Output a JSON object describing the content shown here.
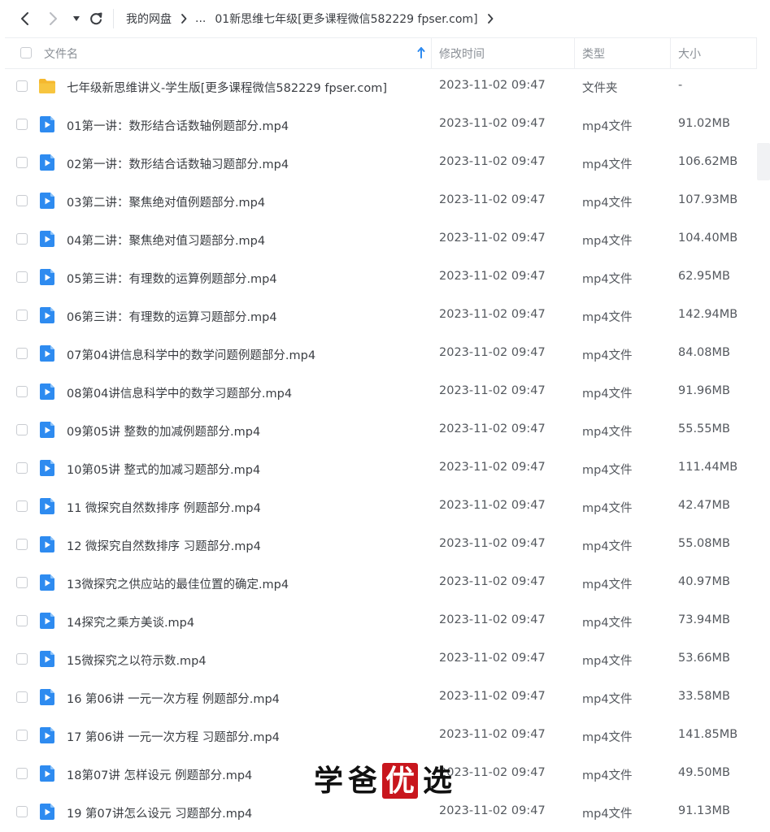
{
  "nav": {
    "back_icon": "chevron-left-icon",
    "forward_icon": "chevron-right-icon",
    "dropdown_icon": "caret-down-icon",
    "refresh_icon": "refresh-icon"
  },
  "breadcrumb": {
    "root": "我的网盘",
    "ellipsis": "...",
    "current": "01新思维七年级[更多课程微信582229 fpser.com]"
  },
  "header": {
    "name": "文件名",
    "modified": "修改时间",
    "type": "类型",
    "size": "大小"
  },
  "colors": {
    "folder": "#f7c53f",
    "video": "#2e8bf0",
    "sort_arrow": "#2e8bf0",
    "watermark_red": "#c8161d"
  },
  "files": [
    {
      "name": "七年级新思维讲义-学生版[更多课程微信582229 fpser.com]",
      "time": "2023-11-02 09:47",
      "type": "文件夹",
      "size": "-",
      "icon": "folder-icon"
    },
    {
      "name": "01第一讲：数形结合话数轴例题部分.mp4",
      "time": "2023-11-02 09:47",
      "type": "mp4文件",
      "size": "91.02MB",
      "icon": "video-file-icon"
    },
    {
      "name": "02第一讲：数形结合话数轴习题部分.mp4",
      "time": "2023-11-02 09:47",
      "type": "mp4文件",
      "size": "106.62MB",
      "icon": "video-file-icon"
    },
    {
      "name": "03第二讲：聚焦绝对值例题部分.mp4",
      "time": "2023-11-02 09:47",
      "type": "mp4文件",
      "size": "107.93MB",
      "icon": "video-file-icon"
    },
    {
      "name": "04第二讲：聚焦绝对值习题部分.mp4",
      "time": "2023-11-02 09:47",
      "type": "mp4文件",
      "size": "104.40MB",
      "icon": "video-file-icon"
    },
    {
      "name": "05第三讲：有理数的运算例题部分.mp4",
      "time": "2023-11-02 09:47",
      "type": "mp4文件",
      "size": "62.95MB",
      "icon": "video-file-icon"
    },
    {
      "name": "06第三讲：有理数的运算习题部分.mp4",
      "time": "2023-11-02 09:47",
      "type": "mp4文件",
      "size": "142.94MB",
      "icon": "video-file-icon"
    },
    {
      "name": "07第04讲信息科学中的数学问题例题部分.mp4",
      "time": "2023-11-02 09:47",
      "type": "mp4文件",
      "size": "84.08MB",
      "icon": "video-file-icon"
    },
    {
      "name": "08第04讲信息科学中的数学习题部分.mp4",
      "time": "2023-11-02 09:47",
      "type": "mp4文件",
      "size": "91.96MB",
      "icon": "video-file-icon"
    },
    {
      "name": "09第05讲 整数的加减例题部分.mp4",
      "time": "2023-11-02 09:47",
      "type": "mp4文件",
      "size": "55.55MB",
      "icon": "video-file-icon"
    },
    {
      "name": "10第05讲 整式的加减习题部分.mp4",
      "time": "2023-11-02 09:47",
      "type": "mp4文件",
      "size": "111.44MB",
      "icon": "video-file-icon"
    },
    {
      "name": "11 微探究自然数排序 例题部分.mp4",
      "time": "2023-11-02 09:47",
      "type": "mp4文件",
      "size": "42.47MB",
      "icon": "video-file-icon"
    },
    {
      "name": "12 微探究自然数排序 习题部分.mp4",
      "time": "2023-11-02 09:47",
      "type": "mp4文件",
      "size": "55.08MB",
      "icon": "video-file-icon"
    },
    {
      "name": "13微探究之供应站的最佳位置的确定.mp4",
      "time": "2023-11-02 09:47",
      "type": "mp4文件",
      "size": "40.97MB",
      "icon": "video-file-icon"
    },
    {
      "name": "14探究之乘方美谈.mp4",
      "time": "2023-11-02 09:47",
      "type": "mp4文件",
      "size": "73.94MB",
      "icon": "video-file-icon"
    },
    {
      "name": "15微探究之以符示数.mp4",
      "time": "2023-11-02 09:47",
      "type": "mp4文件",
      "size": "53.66MB",
      "icon": "video-file-icon"
    },
    {
      "name": "16 第06讲 一元一次方程 例题部分.mp4",
      "time": "2023-11-02 09:47",
      "type": "mp4文件",
      "size": "33.58MB",
      "icon": "video-file-icon"
    },
    {
      "name": "17 第06讲 一元一次方程 习题部分.mp4",
      "time": "2023-11-02 09:47",
      "type": "mp4文件",
      "size": "141.85MB",
      "icon": "video-file-icon"
    },
    {
      "name": "18第07讲 怎样设元 例题部分.mp4",
      "time": "2023-11-02 09:47",
      "type": "mp4文件",
      "size": "49.50MB",
      "icon": "video-file-icon"
    },
    {
      "name": "19 第07讲怎么设元 习题部分.mp4",
      "time": "2023-11-02 09:47",
      "type": "mp4文件",
      "size": "91.13MB",
      "icon": "video-file-icon"
    }
  ],
  "watermark": {
    "c1": "学",
    "c2": "爸",
    "c3": "优",
    "c4": "选"
  }
}
